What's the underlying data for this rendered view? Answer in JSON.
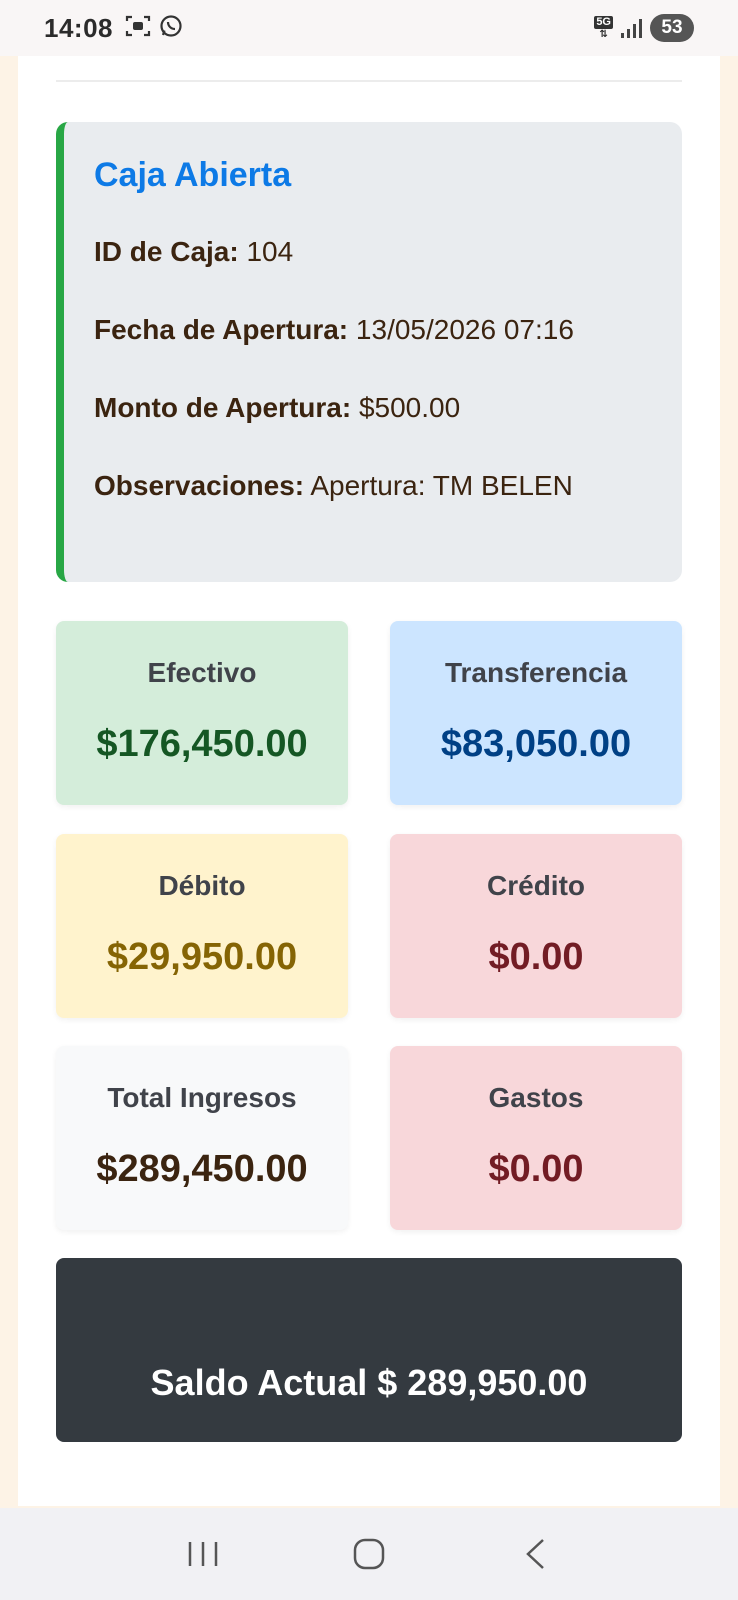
{
  "status_bar": {
    "time": "14:08",
    "network": "5G",
    "battery": "53"
  },
  "caja": {
    "title": "Caja Abierta",
    "fields": [
      {
        "label": "ID de Caja:",
        "value": "104"
      },
      {
        "label": "Fecha de Apertura:",
        "value": "13/05/2026 07:16"
      },
      {
        "label": "Monto de Apertura:",
        "value": "$500.00"
      },
      {
        "label": "Observaciones:",
        "value": "Apertura: TM BELEN"
      }
    ]
  },
  "stats": {
    "efectivo": {
      "label": "Efectivo",
      "value": "$176,450.00"
    },
    "transferencia": {
      "label": "Transferencia",
      "value": "$83,050.00"
    },
    "debito": {
      "label": "Débito",
      "value": "$29,950.00"
    },
    "credito": {
      "label": "Crédito",
      "value": "$0.00"
    },
    "total_ingresos": {
      "label": "Total Ingresos",
      "value": "$289,450.00"
    },
    "gastos": {
      "label": "Gastos",
      "value": "$0.00"
    }
  },
  "saldo": {
    "text": "Saldo Actual $ 289,950.00"
  },
  "colors": {
    "caja_accent": "#28a745",
    "title_blue": "#0d7ae6",
    "efectivo_bg": "#d4edda",
    "efectivo_fg": "#155724",
    "transferencia_bg": "#cce5ff",
    "transferencia_fg": "#004085",
    "debito_bg": "#fff3cd",
    "debito_fg": "#856404",
    "credito_bg": "#f8d7da",
    "credito_fg": "#721c24",
    "total_bg": "#f8f9fa",
    "total_fg": "#3b2410",
    "saldo_bg": "#343a40"
  },
  "nav": {
    "icons": [
      "recent-apps-icon",
      "home-icon",
      "back-icon"
    ]
  }
}
